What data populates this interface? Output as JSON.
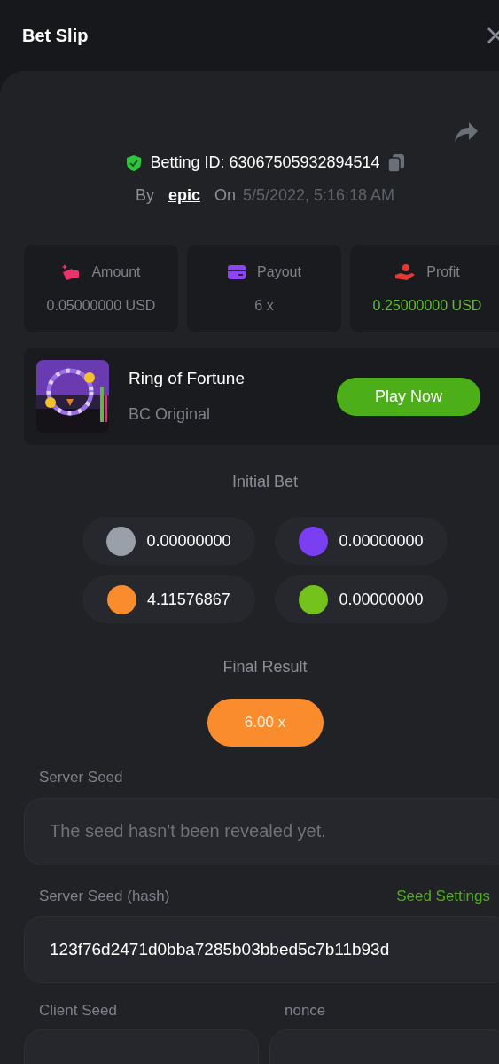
{
  "title": "Bet Slip",
  "betting_id": "Betting ID: 63067505932894514",
  "by_label": "By",
  "user": "epic",
  "on_label": "On",
  "date": "5/5/2022, 5:16:18 AM",
  "stats": [
    {
      "kind": "amount",
      "label": "Amount",
      "value": "0.05000000 USD",
      "positive": false
    },
    {
      "kind": "payout",
      "label": "Payout",
      "value": "6 x",
      "positive": false
    },
    {
      "kind": "profit",
      "label": "Profit",
      "value": "0.25000000 USD",
      "positive": true
    }
  ],
  "game": {
    "name": "Ring of Fortune",
    "provider": "BC Original",
    "button": "Play Now"
  },
  "initial_bet": {
    "title": "Initial Bet",
    "bets": [
      {
        "color": "#9aa0aa",
        "value": "0.00000000"
      },
      {
        "color": "#7b3ff2",
        "value": "0.00000000"
      },
      {
        "color": "#fb8c2e",
        "value": "4.11576867"
      },
      {
        "color": "#74c21c",
        "value": "0.00000000"
      }
    ]
  },
  "final_result": {
    "title": "Final Result",
    "value": "6.00 x"
  },
  "server_seed": {
    "label": "Server Seed",
    "placeholder": "The seed hasn't been revealed yet."
  },
  "server_seed_hash": {
    "label": "Server Seed (hash)",
    "link": "Seed Settings",
    "value": "123f76d2471d0bba7285b03bbed5c7b11b93d"
  },
  "client_seed": {
    "label": "Client Seed"
  },
  "nonce": {
    "label": "nonce"
  }
}
